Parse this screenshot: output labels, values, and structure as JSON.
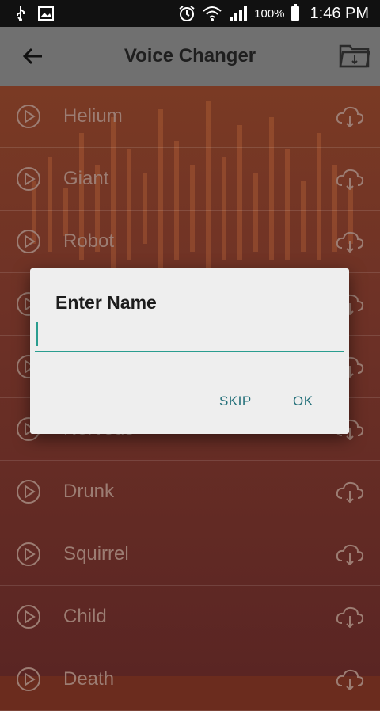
{
  "status_bar": {
    "battery_text": "100%",
    "time": "1:46 PM",
    "icons": [
      "usb-icon",
      "image-icon",
      "alarm-icon",
      "wifi-icon",
      "signal-icon",
      "battery-icon"
    ]
  },
  "app_bar": {
    "title": "Voice Changer",
    "back_icon": "arrow-left-icon",
    "folder_icon": "folder-icon"
  },
  "list": {
    "items": [
      {
        "label": "Helium"
      },
      {
        "label": "Giant"
      },
      {
        "label": "Robot"
      },
      {
        "label": ""
      },
      {
        "label": ""
      },
      {
        "label": "Nervous"
      },
      {
        "label": "Drunk"
      },
      {
        "label": "Squirrel"
      },
      {
        "label": "Child"
      },
      {
        "label": "Death"
      }
    ]
  },
  "dialog": {
    "title": "Enter Name",
    "input_value": "",
    "skip_label": "SKIP",
    "ok_label": "OK"
  },
  "colors": {
    "accent": "#2a9d8f",
    "button_text": "#24707a",
    "app_bar": "#707070",
    "status_bar": "#111111"
  }
}
